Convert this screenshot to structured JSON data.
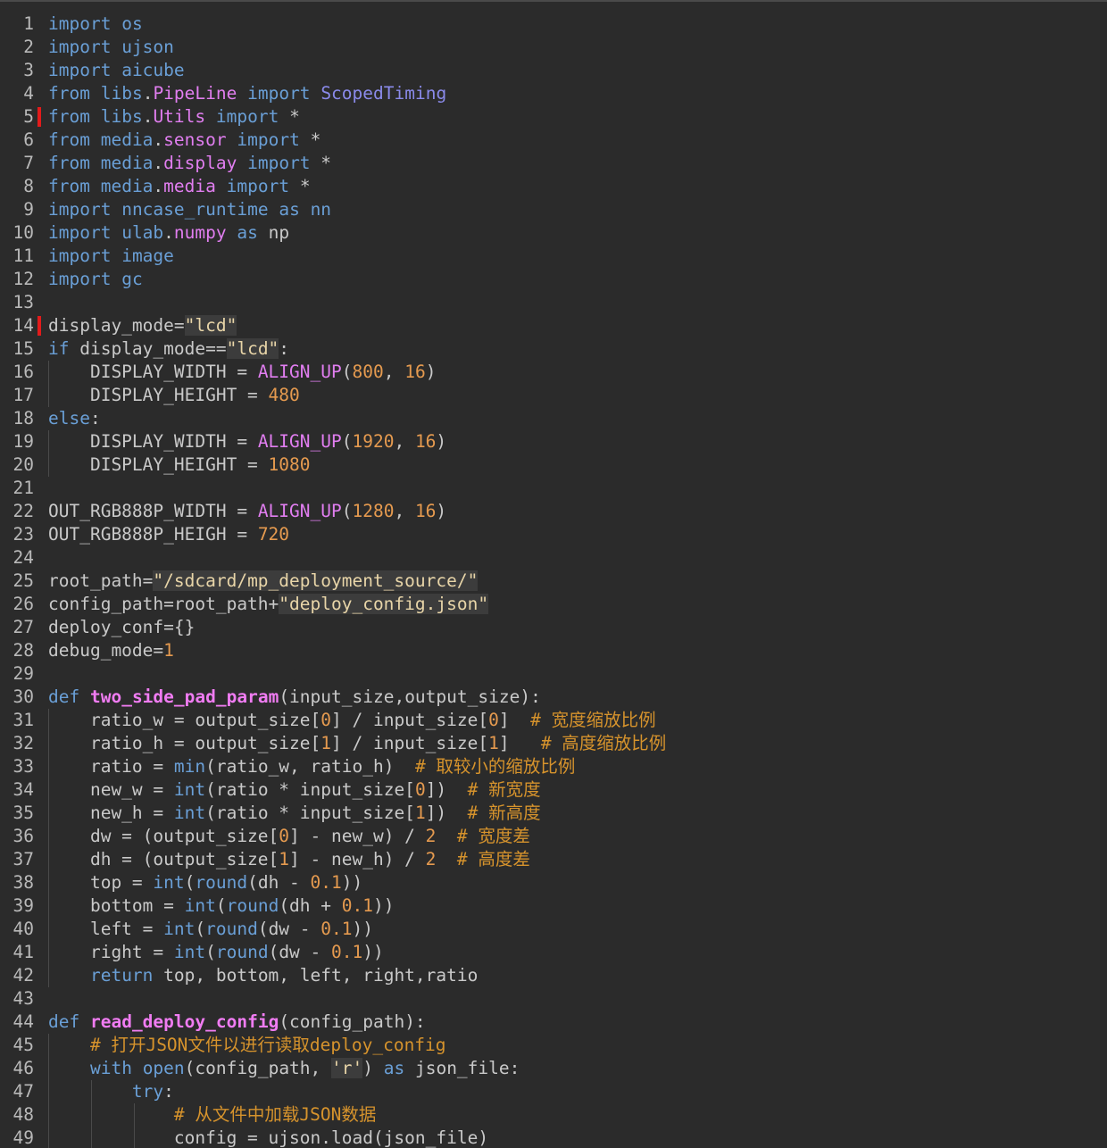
{
  "editor": {
    "lines": [
      {
        "n": "1",
        "marker": false,
        "indent": 0,
        "tokens": [
          [
            "keyword",
            "import"
          ],
          [
            "plain",
            " "
          ],
          [
            "module",
            "os"
          ]
        ]
      },
      {
        "n": "2",
        "marker": false,
        "indent": 0,
        "tokens": [
          [
            "keyword",
            "import"
          ],
          [
            "plain",
            " "
          ],
          [
            "module",
            "ujson"
          ]
        ]
      },
      {
        "n": "3",
        "marker": false,
        "indent": 0,
        "tokens": [
          [
            "keyword",
            "import"
          ],
          [
            "plain",
            " "
          ],
          [
            "module",
            "aicube"
          ]
        ]
      },
      {
        "n": "4",
        "marker": false,
        "indent": 0,
        "tokens": [
          [
            "keyword",
            "from"
          ],
          [
            "plain",
            " "
          ],
          [
            "module",
            "libs"
          ],
          [
            "plain",
            "."
          ],
          [
            "attr",
            "PipeLine"
          ],
          [
            "plain",
            " "
          ],
          [
            "keyword",
            "import"
          ],
          [
            "plain",
            " "
          ],
          [
            "class",
            "ScopedTiming"
          ]
        ]
      },
      {
        "n": "5",
        "marker": true,
        "indent": 0,
        "tokens": [
          [
            "keyword",
            "from"
          ],
          [
            "plain",
            " "
          ],
          [
            "module",
            "libs"
          ],
          [
            "plain",
            "."
          ],
          [
            "attr",
            "Utils"
          ],
          [
            "plain",
            " "
          ],
          [
            "keyword",
            "import"
          ],
          [
            "plain",
            " *"
          ]
        ]
      },
      {
        "n": "6",
        "marker": false,
        "indent": 0,
        "tokens": [
          [
            "keyword",
            "from"
          ],
          [
            "plain",
            " "
          ],
          [
            "module",
            "media"
          ],
          [
            "plain",
            "."
          ],
          [
            "attr",
            "sensor"
          ],
          [
            "plain",
            " "
          ],
          [
            "keyword",
            "import"
          ],
          [
            "plain",
            " *"
          ]
        ]
      },
      {
        "n": "7",
        "marker": false,
        "indent": 0,
        "tokens": [
          [
            "keyword",
            "from"
          ],
          [
            "plain",
            " "
          ],
          [
            "module",
            "media"
          ],
          [
            "plain",
            "."
          ],
          [
            "attr",
            "display"
          ],
          [
            "plain",
            " "
          ],
          [
            "keyword",
            "import"
          ],
          [
            "plain",
            " *"
          ]
        ]
      },
      {
        "n": "8",
        "marker": false,
        "indent": 0,
        "tokens": [
          [
            "keyword",
            "from"
          ],
          [
            "plain",
            " "
          ],
          [
            "module",
            "media"
          ],
          [
            "plain",
            "."
          ],
          [
            "attr",
            "media"
          ],
          [
            "plain",
            " "
          ],
          [
            "keyword",
            "import"
          ],
          [
            "plain",
            " *"
          ]
        ]
      },
      {
        "n": "9",
        "marker": false,
        "indent": 0,
        "tokens": [
          [
            "keyword",
            "import"
          ],
          [
            "plain",
            " "
          ],
          [
            "module",
            "nncase_runtime"
          ],
          [
            "plain",
            " "
          ],
          [
            "keyword",
            "as"
          ],
          [
            "plain",
            " "
          ],
          [
            "module",
            "nn"
          ]
        ]
      },
      {
        "n": "10",
        "marker": false,
        "indent": 0,
        "tokens": [
          [
            "keyword",
            "import"
          ],
          [
            "plain",
            " "
          ],
          [
            "module",
            "ulab"
          ],
          [
            "plain",
            "."
          ],
          [
            "attr",
            "numpy"
          ],
          [
            "plain",
            " "
          ],
          [
            "keyword",
            "as"
          ],
          [
            "plain",
            " np"
          ]
        ]
      },
      {
        "n": "11",
        "marker": false,
        "indent": 0,
        "tokens": [
          [
            "keyword",
            "import"
          ],
          [
            "plain",
            " "
          ],
          [
            "module",
            "image"
          ]
        ]
      },
      {
        "n": "12",
        "marker": false,
        "indent": 0,
        "tokens": [
          [
            "keyword",
            "import"
          ],
          [
            "plain",
            " "
          ],
          [
            "module",
            "gc"
          ]
        ]
      },
      {
        "n": "13",
        "marker": false,
        "indent": 0,
        "tokens": []
      },
      {
        "n": "14",
        "marker": true,
        "indent": 0,
        "tokens": [
          [
            "plain",
            "display_mode="
          ],
          [
            "string",
            "\"lcd\""
          ]
        ]
      },
      {
        "n": "15",
        "marker": false,
        "indent": 0,
        "tokens": [
          [
            "keyword",
            "if"
          ],
          [
            "plain",
            " display_mode=="
          ],
          [
            "string",
            "\"lcd\""
          ],
          [
            "plain",
            ":"
          ]
        ]
      },
      {
        "n": "16",
        "marker": false,
        "indent": 1,
        "tokens": [
          [
            "plain",
            "    DISPLAY_WIDTH = "
          ],
          [
            "func",
            "ALIGN_UP"
          ],
          [
            "plain",
            "("
          ],
          [
            "number",
            "800"
          ],
          [
            "plain",
            ", "
          ],
          [
            "number",
            "16"
          ],
          [
            "plain",
            ")"
          ]
        ]
      },
      {
        "n": "17",
        "marker": false,
        "indent": 1,
        "tokens": [
          [
            "plain",
            "    DISPLAY_HEIGHT = "
          ],
          [
            "number",
            "480"
          ]
        ]
      },
      {
        "n": "18",
        "marker": false,
        "indent": 0,
        "tokens": [
          [
            "keyword",
            "else"
          ],
          [
            "plain",
            ":"
          ]
        ]
      },
      {
        "n": "19",
        "marker": false,
        "indent": 1,
        "tokens": [
          [
            "plain",
            "    DISPLAY_WIDTH = "
          ],
          [
            "func",
            "ALIGN_UP"
          ],
          [
            "plain",
            "("
          ],
          [
            "number",
            "1920"
          ],
          [
            "plain",
            ", "
          ],
          [
            "number",
            "16"
          ],
          [
            "plain",
            ")"
          ]
        ]
      },
      {
        "n": "20",
        "marker": false,
        "indent": 1,
        "tokens": [
          [
            "plain",
            "    DISPLAY_HEIGHT = "
          ],
          [
            "number",
            "1080"
          ]
        ]
      },
      {
        "n": "21",
        "marker": false,
        "indent": 0,
        "tokens": []
      },
      {
        "n": "22",
        "marker": false,
        "indent": 0,
        "tokens": [
          [
            "plain",
            "OUT_RGB888P_WIDTH = "
          ],
          [
            "func",
            "ALIGN_UP"
          ],
          [
            "plain",
            "("
          ],
          [
            "number",
            "1280"
          ],
          [
            "plain",
            ", "
          ],
          [
            "number",
            "16"
          ],
          [
            "plain",
            ")"
          ]
        ]
      },
      {
        "n": "23",
        "marker": false,
        "indent": 0,
        "tokens": [
          [
            "plain",
            "OUT_RGB888P_HEIGH = "
          ],
          [
            "number",
            "720"
          ]
        ]
      },
      {
        "n": "24",
        "marker": false,
        "indent": 0,
        "tokens": []
      },
      {
        "n": "25",
        "marker": false,
        "indent": 0,
        "tokens": [
          [
            "plain",
            "root_path="
          ],
          [
            "string",
            "\"/sdcard/mp_deployment_source/\""
          ]
        ]
      },
      {
        "n": "26",
        "marker": false,
        "indent": 0,
        "tokens": [
          [
            "plain",
            "config_path=root_path+"
          ],
          [
            "string",
            "\"deploy_config.json\""
          ]
        ]
      },
      {
        "n": "27",
        "marker": false,
        "indent": 0,
        "tokens": [
          [
            "plain",
            "deploy_conf={}"
          ]
        ]
      },
      {
        "n": "28",
        "marker": false,
        "indent": 0,
        "tokens": [
          [
            "plain",
            "debug_mode="
          ],
          [
            "number",
            "1"
          ]
        ]
      },
      {
        "n": "29",
        "marker": false,
        "indent": 0,
        "tokens": []
      },
      {
        "n": "30",
        "marker": false,
        "indent": 0,
        "tokens": [
          [
            "keyword",
            "def"
          ],
          [
            "plain",
            " "
          ],
          [
            "defname",
            "two_side_pad_param"
          ],
          [
            "plain",
            "(input_size,output_size):"
          ]
        ]
      },
      {
        "n": "31",
        "marker": false,
        "indent": 1,
        "tokens": [
          [
            "plain",
            "    ratio_w = output_size["
          ],
          [
            "number",
            "0"
          ],
          [
            "plain",
            "] / input_size["
          ],
          [
            "number",
            "0"
          ],
          [
            "plain",
            "]  "
          ],
          [
            "comment",
            "# 宽度缩放比例"
          ]
        ]
      },
      {
        "n": "32",
        "marker": false,
        "indent": 1,
        "tokens": [
          [
            "plain",
            "    ratio_h = output_size["
          ],
          [
            "number",
            "1"
          ],
          [
            "plain",
            "] / input_size["
          ],
          [
            "number",
            "1"
          ],
          [
            "plain",
            "]   "
          ],
          [
            "comment",
            "# 高度缩放比例"
          ]
        ]
      },
      {
        "n": "33",
        "marker": false,
        "indent": 1,
        "tokens": [
          [
            "plain",
            "    ratio = "
          ],
          [
            "builtin",
            "min"
          ],
          [
            "plain",
            "(ratio_w, ratio_h)  "
          ],
          [
            "comment",
            "# 取较小的缩放比例"
          ]
        ]
      },
      {
        "n": "34",
        "marker": false,
        "indent": 1,
        "tokens": [
          [
            "plain",
            "    new_w = "
          ],
          [
            "builtin",
            "int"
          ],
          [
            "plain",
            "(ratio * input_size["
          ],
          [
            "number",
            "0"
          ],
          [
            "plain",
            "])  "
          ],
          [
            "comment",
            "# 新宽度"
          ]
        ]
      },
      {
        "n": "35",
        "marker": false,
        "indent": 1,
        "tokens": [
          [
            "plain",
            "    new_h = "
          ],
          [
            "builtin",
            "int"
          ],
          [
            "plain",
            "(ratio * input_size["
          ],
          [
            "number",
            "1"
          ],
          [
            "plain",
            "])  "
          ],
          [
            "comment",
            "# 新高度"
          ]
        ]
      },
      {
        "n": "36",
        "marker": false,
        "indent": 1,
        "tokens": [
          [
            "plain",
            "    dw = (output_size["
          ],
          [
            "number",
            "0"
          ],
          [
            "plain",
            "] - new_w) / "
          ],
          [
            "number",
            "2"
          ],
          [
            "plain",
            "  "
          ],
          [
            "comment",
            "# 宽度差"
          ]
        ]
      },
      {
        "n": "37",
        "marker": false,
        "indent": 1,
        "tokens": [
          [
            "plain",
            "    dh = (output_size["
          ],
          [
            "number",
            "1"
          ],
          [
            "plain",
            "] - new_h) / "
          ],
          [
            "number",
            "2"
          ],
          [
            "plain",
            "  "
          ],
          [
            "comment",
            "# 高度差"
          ]
        ]
      },
      {
        "n": "38",
        "marker": false,
        "indent": 1,
        "tokens": [
          [
            "plain",
            "    top = "
          ],
          [
            "builtin",
            "int"
          ],
          [
            "plain",
            "("
          ],
          [
            "builtin",
            "round"
          ],
          [
            "plain",
            "(dh - "
          ],
          [
            "number",
            "0.1"
          ],
          [
            "plain",
            "))"
          ]
        ]
      },
      {
        "n": "39",
        "marker": false,
        "indent": 1,
        "tokens": [
          [
            "plain",
            "    bottom = "
          ],
          [
            "builtin",
            "int"
          ],
          [
            "plain",
            "("
          ],
          [
            "builtin",
            "round"
          ],
          [
            "plain",
            "(dh + "
          ],
          [
            "number",
            "0.1"
          ],
          [
            "plain",
            "))"
          ]
        ]
      },
      {
        "n": "40",
        "marker": false,
        "indent": 1,
        "tokens": [
          [
            "plain",
            "    left = "
          ],
          [
            "builtin",
            "int"
          ],
          [
            "plain",
            "("
          ],
          [
            "builtin",
            "round"
          ],
          [
            "plain",
            "(dw - "
          ],
          [
            "number",
            "0.1"
          ],
          [
            "plain",
            "))"
          ]
        ]
      },
      {
        "n": "41",
        "marker": false,
        "indent": 1,
        "tokens": [
          [
            "plain",
            "    right = "
          ],
          [
            "builtin",
            "int"
          ],
          [
            "plain",
            "("
          ],
          [
            "builtin",
            "round"
          ],
          [
            "plain",
            "(dw - "
          ],
          [
            "number",
            "0.1"
          ],
          [
            "plain",
            "))"
          ]
        ]
      },
      {
        "n": "42",
        "marker": false,
        "indent": 1,
        "tokens": [
          [
            "plain",
            "    "
          ],
          [
            "keyword",
            "return"
          ],
          [
            "plain",
            " top, bottom, left, right,ratio"
          ]
        ]
      },
      {
        "n": "43",
        "marker": false,
        "indent": 0,
        "tokens": []
      },
      {
        "n": "44",
        "marker": false,
        "indent": 0,
        "tokens": [
          [
            "keyword",
            "def"
          ],
          [
            "plain",
            " "
          ],
          [
            "defname",
            "read_deploy_config"
          ],
          [
            "plain",
            "(config_path):"
          ]
        ]
      },
      {
        "n": "45",
        "marker": false,
        "indent": 1,
        "tokens": [
          [
            "plain",
            "    "
          ],
          [
            "comment",
            "# 打开JSON文件以进行读取deploy_config"
          ]
        ]
      },
      {
        "n": "46",
        "marker": false,
        "indent": 1,
        "tokens": [
          [
            "plain",
            "    "
          ],
          [
            "keyword",
            "with"
          ],
          [
            "plain",
            " "
          ],
          [
            "builtin",
            "open"
          ],
          [
            "plain",
            "(config_path, "
          ],
          [
            "string",
            "'r'"
          ],
          [
            "plain",
            ") "
          ],
          [
            "keyword",
            "as"
          ],
          [
            "plain",
            " json_file:"
          ]
        ]
      },
      {
        "n": "47",
        "marker": false,
        "indent": 2,
        "tokens": [
          [
            "plain",
            "        "
          ],
          [
            "keyword",
            "try"
          ],
          [
            "plain",
            ":"
          ]
        ]
      },
      {
        "n": "48",
        "marker": false,
        "indent": 3,
        "tokens": [
          [
            "plain",
            "            "
          ],
          [
            "comment",
            "# 从文件中加载JSON数据"
          ]
        ]
      },
      {
        "n": "49",
        "marker": false,
        "indent": 3,
        "tokens": [
          [
            "plain",
            "            config = ujson.load(json_file)"
          ]
        ]
      }
    ]
  }
}
